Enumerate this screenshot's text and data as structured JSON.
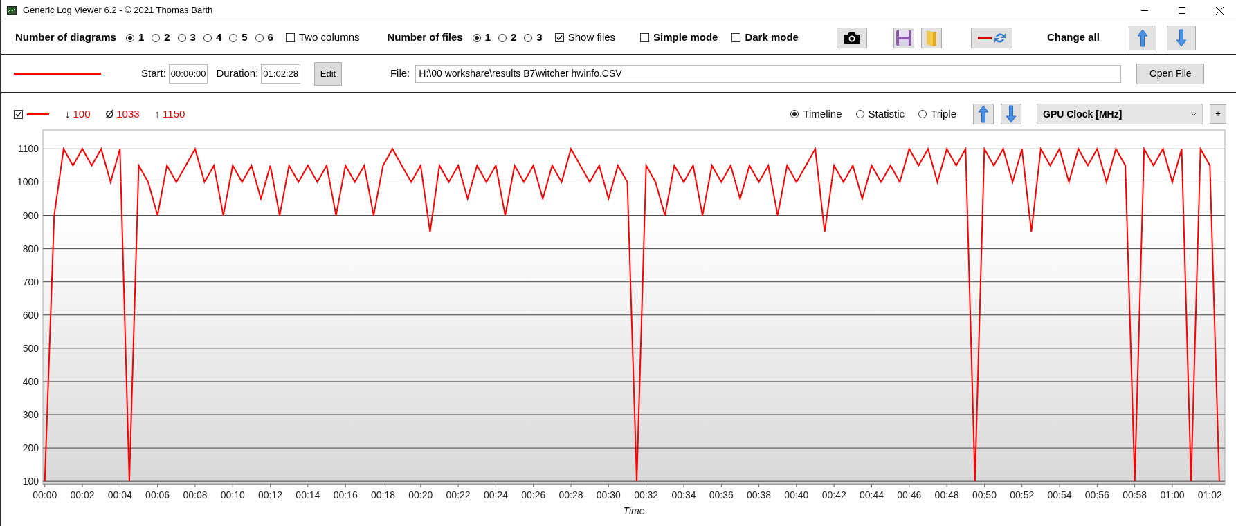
{
  "window": {
    "title": "Generic Log Viewer 6.2 - © 2021 Thomas Barth"
  },
  "toolbar": {
    "diagrams_label": "Number of diagrams",
    "diagram_options": [
      {
        "label": "1",
        "selected": true
      },
      {
        "label": "2",
        "selected": false
      },
      {
        "label": "3",
        "selected": false
      },
      {
        "label": "4",
        "selected": false
      },
      {
        "label": "5",
        "selected": false
      },
      {
        "label": "6",
        "selected": false
      }
    ],
    "two_columns": {
      "label": "Two columns",
      "checked": false
    },
    "files_label": "Number of files",
    "file_options": [
      {
        "label": "1",
        "selected": true
      },
      {
        "label": "2",
        "selected": false
      },
      {
        "label": "3",
        "selected": false
      }
    ],
    "show_files": {
      "label": "Show files",
      "checked": true
    },
    "simple_mode": {
      "label": "Simple mode",
      "checked": false
    },
    "dark_mode": {
      "label": "Dark mode",
      "checked": false
    },
    "change_all_label": "Change all"
  },
  "file_row": {
    "start_label": "Start:",
    "start_value": "00:00:00",
    "duration_label": "Duration:",
    "duration_value": "01:02:28",
    "edit_button": "Edit",
    "file_label": "File:",
    "file_path": "H:\\00 workshare\\results B7\\witcher hwinfo.CSV",
    "open_button": "Open File"
  },
  "diagram": {
    "visible": {
      "checked": true
    },
    "min": {
      "arrow": "↓",
      "value": "100"
    },
    "avg": {
      "symbol": "Ø",
      "value": "1033"
    },
    "max": {
      "arrow": "↑",
      "value": "1150"
    },
    "view_modes": [
      {
        "label": "Timeline",
        "selected": true
      },
      {
        "label": "Statistic",
        "selected": false
      },
      {
        "label": "Triple",
        "selected": false
      }
    ],
    "channel_select": {
      "value": "GPU Clock [MHz]"
    },
    "add_button": "+",
    "chart_data": {
      "type": "line",
      "grid": true,
      "xlabel": "Time",
      "xlim": [
        -0.1,
        62.8
      ],
      "ylim": [
        92,
        1157
      ],
      "x": [
        0,
        0.5,
        1,
        1.5,
        2,
        2.5,
        3,
        3.5,
        4,
        4.5,
        5,
        5.5,
        6,
        6.5,
        7,
        7.5,
        8,
        8.5,
        9,
        9.5,
        10,
        10.5,
        11,
        11.5,
        12,
        12.5,
        13,
        13.5,
        14,
        14.5,
        15,
        15.5,
        16,
        16.5,
        17,
        17.5,
        18,
        18.5,
        19,
        19.5,
        20,
        20.5,
        21,
        21.5,
        22,
        22.5,
        23,
        23.5,
        24,
        24.5,
        25,
        25.5,
        26,
        26.5,
        27,
        27.5,
        28,
        28.5,
        29,
        29.5,
        30,
        30.5,
        31,
        31.5,
        32,
        32.5,
        33,
        33.5,
        34,
        34.5,
        35,
        35.5,
        36,
        36.5,
        37,
        37.5,
        38,
        38.5,
        39,
        39.5,
        40,
        40.5,
        41,
        41.5,
        42,
        42.5,
        43,
        43.5,
        44,
        44.5,
        45,
        45.5,
        46,
        46.5,
        47,
        47.5,
        48,
        48.5,
        49,
        49.5,
        50,
        50.5,
        51,
        51.5,
        52,
        52.5,
        53,
        53.5,
        54,
        54.5,
        55,
        55.5,
        56,
        56.5,
        57,
        57.5,
        58,
        58.5,
        59,
        59.5,
        60,
        60.5,
        61,
        61.5,
        62,
        62.5
      ],
      "series": [
        {
          "color": "#ff0000",
          "values": [
            100,
            900,
            1100,
            1050,
            1100,
            1050,
            1100,
            1000,
            1100,
            100,
            1050,
            1000,
            900,
            1050,
            1000,
            1050,
            1100,
            1000,
            1050,
            900,
            1050,
            1000,
            1050,
            950,
            1050,
            900,
            1050,
            1000,
            1050,
            1000,
            1050,
            900,
            1050,
            1000,
            1050,
            900,
            1050,
            1100,
            1050,
            1000,
            1050,
            850,
            1050,
            1000,
            1050,
            950,
            1050,
            1000,
            1050,
            900,
            1050,
            1000,
            1050,
            950,
            1050,
            1000,
            1100,
            1050,
            1000,
            1050,
            950,
            1050,
            1000,
            100,
            1050,
            1000,
            900,
            1050,
            1000,
            1050,
            900,
            1050,
            1000,
            1050,
            950,
            1050,
            1000,
            1050,
            900,
            1050,
            1000,
            1050,
            1100,
            850,
            1050,
            1000,
            1050,
            950,
            1050,
            1000,
            1050,
            1000,
            1100,
            1050,
            1100,
            1000,
            1100,
            1050,
            1100,
            100,
            1100,
            1050,
            1100,
            1000,
            1100,
            850,
            1100,
            1050,
            1100,
            1000,
            1100,
            1050,
            1100,
            1000,
            1100,
            1050,
            100,
            1100,
            1050,
            1100,
            1000,
            1100,
            100,
            1100,
            1050,
            100
          ]
        }
      ],
      "xticks": [
        {
          "value": 0,
          "label": "00:00"
        },
        {
          "value": 2,
          "label": "00:02"
        },
        {
          "value": 4,
          "label": "00:04"
        },
        {
          "value": 6,
          "label": "00:06"
        },
        {
          "value": 8,
          "label": "00:08"
        },
        {
          "value": 10,
          "label": "00:10"
        },
        {
          "value": 12,
          "label": "00:12"
        },
        {
          "value": 14,
          "label": "00:14"
        },
        {
          "value": 16,
          "label": "00:16"
        },
        {
          "value": 18,
          "label": "00:18"
        },
        {
          "value": 20,
          "label": "00:20"
        },
        {
          "value": 22,
          "label": "00:22"
        },
        {
          "value": 24,
          "label": "00:24"
        },
        {
          "value": 26,
          "label": "00:26"
        },
        {
          "value": 28,
          "label": "00:28"
        },
        {
          "value": 30,
          "label": "00:30"
        },
        {
          "value": 32,
          "label": "00:32"
        },
        {
          "value": 34,
          "label": "00:34"
        },
        {
          "value": 36,
          "label": "00:36"
        },
        {
          "value": 38,
          "label": "00:38"
        },
        {
          "value": 40,
          "label": "00:40"
        },
        {
          "value": 42,
          "label": "00:42"
        },
        {
          "value": 44,
          "label": "00:44"
        },
        {
          "value": 46,
          "label": "00:46"
        },
        {
          "value": 48,
          "label": "00:48"
        },
        {
          "value": 50,
          "label": "00:50"
        },
        {
          "value": 52,
          "label": "00:52"
        },
        {
          "value": 54,
          "label": "00:54"
        },
        {
          "value": 56,
          "label": "00:56"
        },
        {
          "value": 58,
          "label": "00:58"
        },
        {
          "value": 60,
          "label": "01:00"
        },
        {
          "value": 62,
          "label": "01:02"
        }
      ],
      "yticks": [
        100,
        200,
        300,
        400,
        500,
        600,
        700,
        800,
        900,
        1000,
        1100
      ]
    }
  }
}
